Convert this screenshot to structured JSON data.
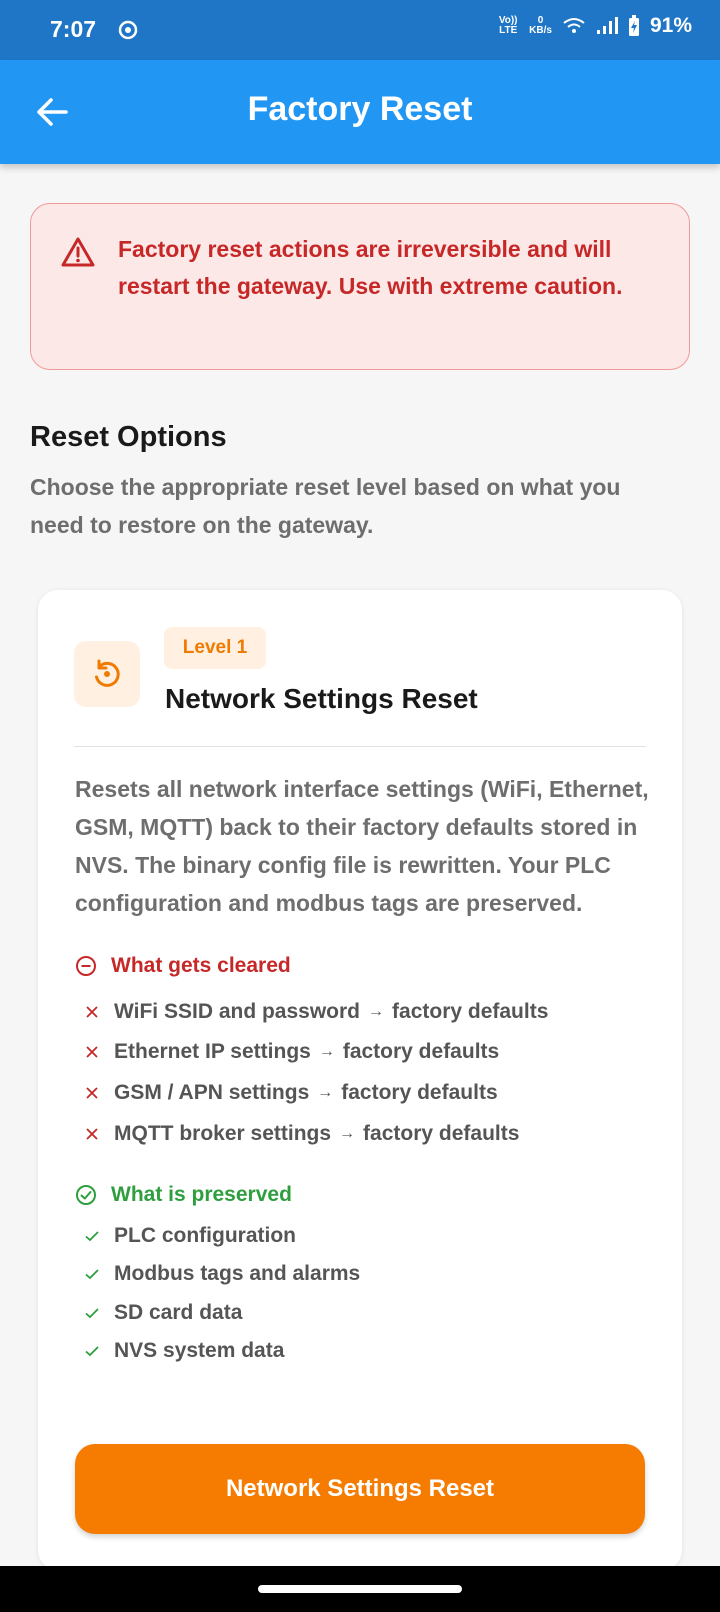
{
  "status_bar": {
    "time": "7:07",
    "volte": "Vo)) LTE",
    "data_rate": "0",
    "data_rate_unit": "KB/s",
    "battery_percent": "91%"
  },
  "app_bar": {
    "title": "Factory Reset",
    "back_icon": "arrow-left-icon"
  },
  "warning": {
    "icon": "warning-triangle-icon",
    "text": "Factory reset actions are irreversible and will restart the gateway. Use with extreme caution."
  },
  "reset_options": {
    "title": "Reset Options",
    "description": "Choose the appropriate reset level based on what you need to restore on the gateway."
  },
  "card": {
    "icon": "restore-icon",
    "level_badge": "Level 1",
    "title": "Network Settings Reset",
    "description": "Resets all network interface settings (WiFi, Ethernet, GSM, MQTT) back to their factory defaults stored in NVS. The binary config file is rewritten. Your PLC configuration and modbus tags are preserved.",
    "cleared_heading": "What gets cleared",
    "cleared_items": [
      {
        "label": "WiFi SSID and password",
        "arrow": "→",
        "target": "factory defaults"
      },
      {
        "label": "Ethernet IP settings",
        "arrow": "→",
        "target": "factory defaults"
      },
      {
        "label": "GSM / APN settings",
        "arrow": "→",
        "target": "factory defaults"
      },
      {
        "label": "MQTT broker settings",
        "arrow": "→",
        "target": "factory defaults"
      }
    ],
    "preserved_heading": "What is preserved",
    "preserved_items": [
      {
        "label": "PLC configuration"
      },
      {
        "label": "Modbus tags and alarms"
      },
      {
        "label": "SD card data"
      },
      {
        "label": "NVS system data"
      }
    ],
    "button_label": "Network Settings Reset"
  },
  "colors": {
    "app_bar": "#2196f3",
    "status_bar": "#1f76c7",
    "danger": "#c62828",
    "success": "#2e9e3e",
    "accent": "#f57c00"
  }
}
